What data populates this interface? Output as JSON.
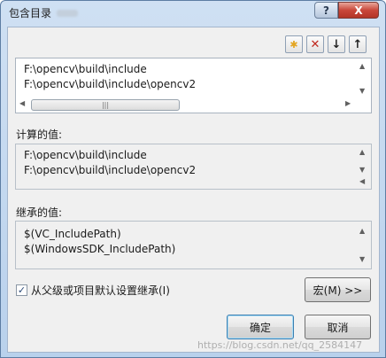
{
  "window": {
    "title": "包含目录",
    "help_label": "?",
    "close_label": "X"
  },
  "toolbar": {
    "new_line_icon": "new-line-icon",
    "delete_icon": "delete-icon",
    "move_down_icon": "move-down-icon",
    "move_up_icon": "move-up-icon",
    "delete_glyph": "✕",
    "down_glyph": "↓",
    "up_glyph": "↑",
    "new_glyph": "✱"
  },
  "directories": {
    "items": [
      "F:\\opencv\\build\\include",
      "F:\\opencv\\build\\include\\opencv2"
    ]
  },
  "evaluated": {
    "label": "计算的值:",
    "items": [
      "F:\\opencv\\build\\include",
      "F:\\opencv\\build\\include\\opencv2"
    ]
  },
  "inherited": {
    "label": "继承的值:",
    "items": [
      "$(VC_IncludePath)",
      "$(WindowsSDK_IncludePath)"
    ]
  },
  "inherit_checkbox": {
    "label": "从父级或项目默认设置继承(I)",
    "checked": true
  },
  "buttons": {
    "macros": "宏(M) >>",
    "ok": "确定",
    "cancel": "取消"
  },
  "watermark": "https://blog.csdn.net/qq_2584147",
  "colors": {
    "titlebar": "#cfe0f3",
    "close": "#c9473a",
    "delete_icon": "#c0281e",
    "new_icon": "#e3a521"
  }
}
